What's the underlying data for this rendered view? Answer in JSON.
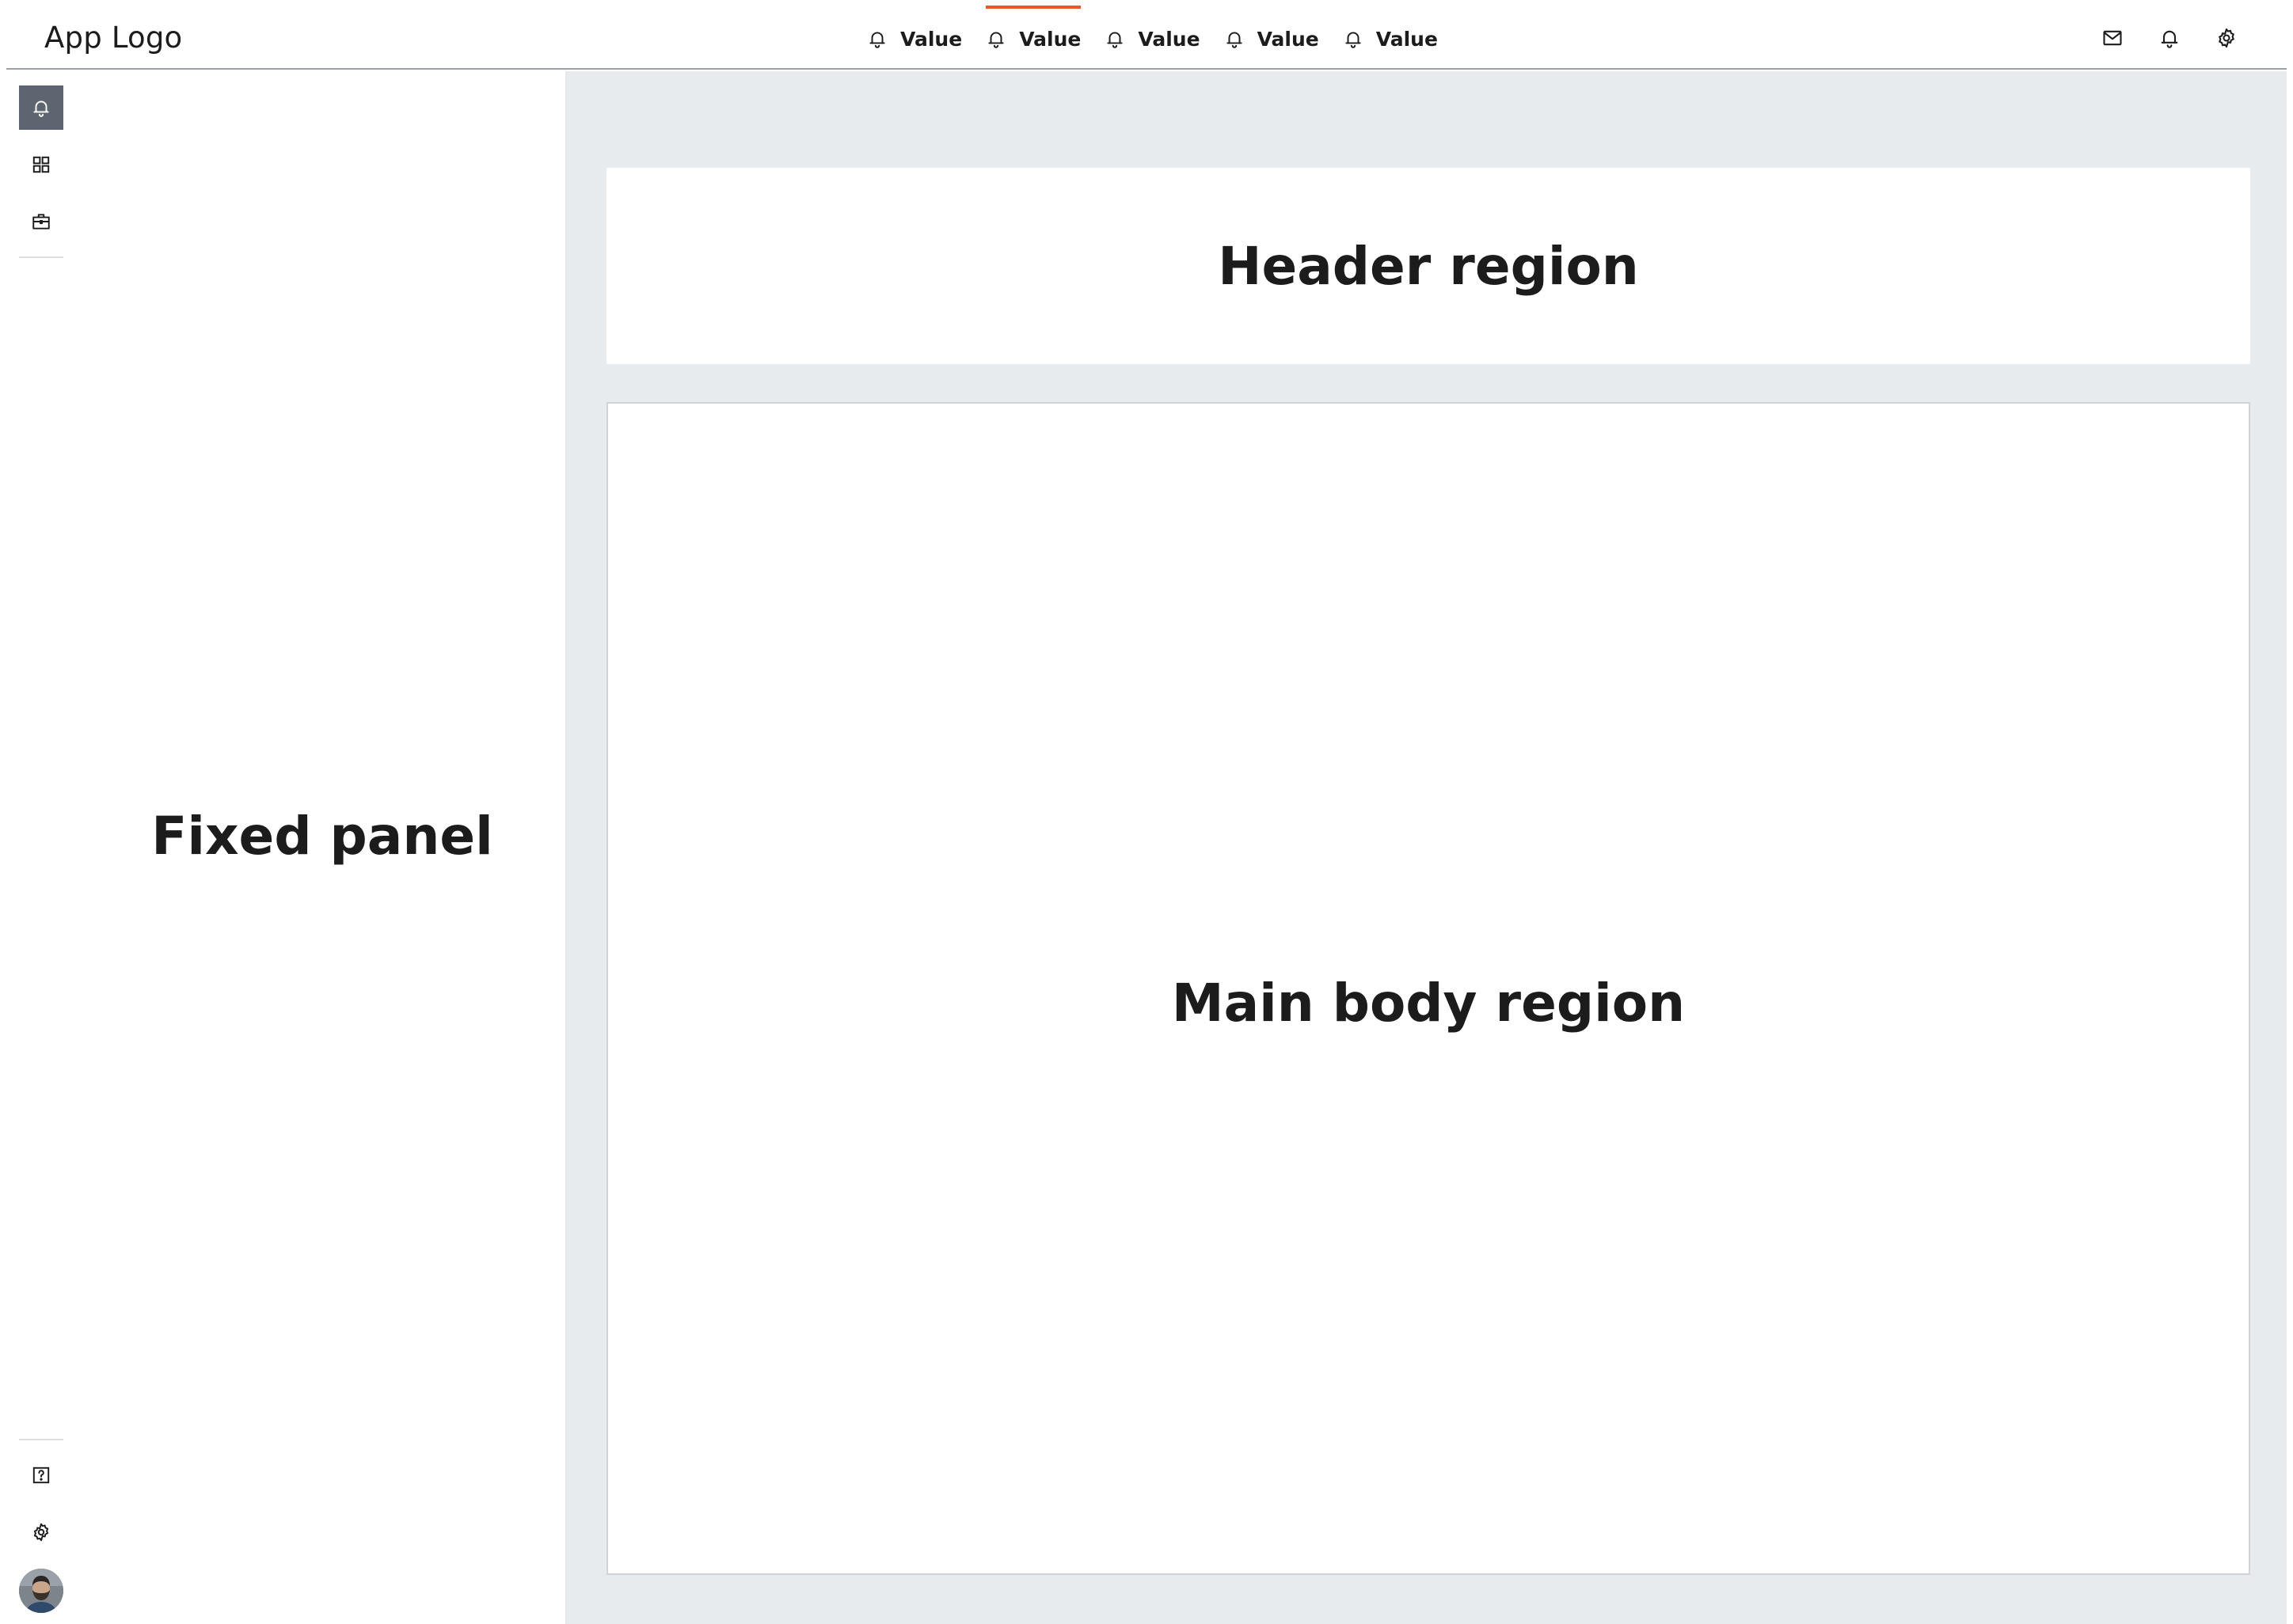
{
  "app": {
    "logo_text": "App Logo"
  },
  "top_nav": {
    "tabs": [
      {
        "label": "Value",
        "icon": "bell-icon",
        "active": false
      },
      {
        "label": "Value",
        "icon": "bell-icon",
        "active": true
      },
      {
        "label": "Value",
        "icon": "bell-icon",
        "active": false
      },
      {
        "label": "Value",
        "icon": "bell-icon",
        "active": false
      },
      {
        "label": "Value",
        "icon": "bell-icon",
        "active": false
      }
    ],
    "actions": [
      {
        "icon": "mail-icon"
      },
      {
        "icon": "bell-icon"
      },
      {
        "icon": "gear-icon"
      }
    ],
    "active_tab_color": "#e8582a"
  },
  "rail": {
    "top_items": [
      {
        "icon": "bell-icon",
        "active": true
      },
      {
        "icon": "grid-icon",
        "active": false
      },
      {
        "icon": "briefcase-icon",
        "active": false
      }
    ],
    "bottom_items": [
      {
        "icon": "help-icon"
      },
      {
        "icon": "gear-icon"
      },
      {
        "icon": "user-avatar"
      }
    ],
    "active_bg_color": "#5e6470"
  },
  "fixed_panel": {
    "title": "Fixed panel"
  },
  "header_region": {
    "title": "Header region"
  },
  "main_region": {
    "title": "Main body region"
  },
  "colors": {
    "content_bg": "#e8ebee",
    "surface": "#ffffff"
  }
}
